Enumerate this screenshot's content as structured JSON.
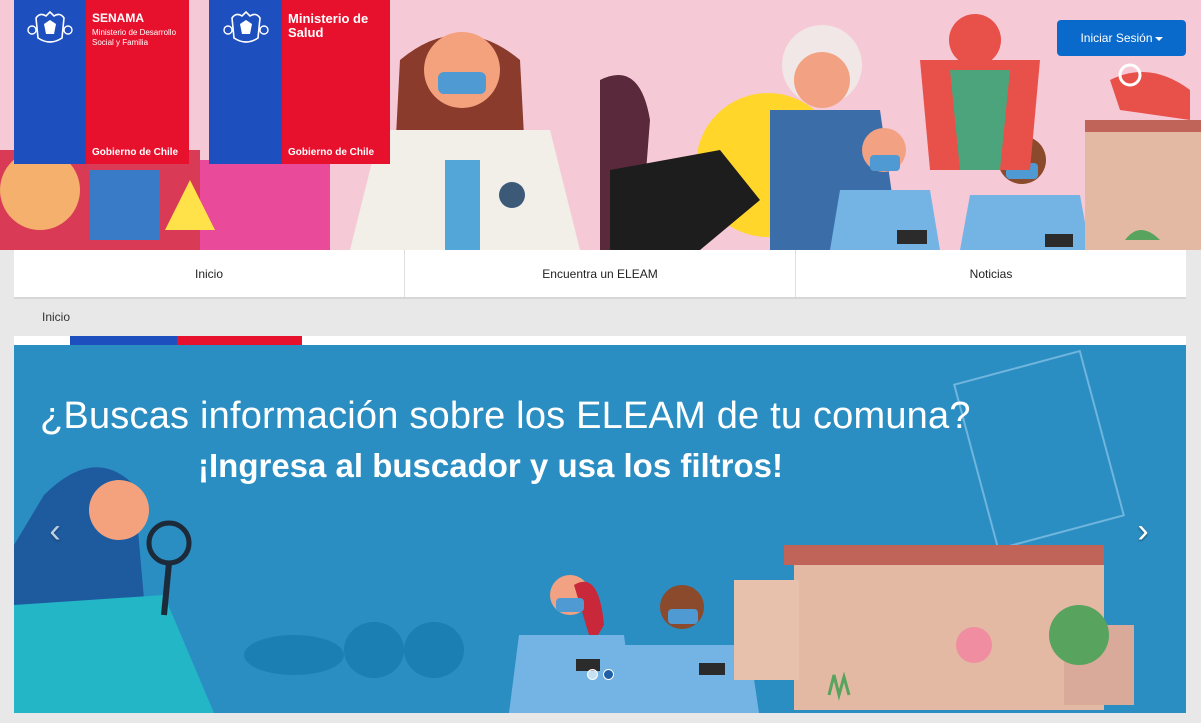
{
  "header": {
    "logo_senama": {
      "title": "SENAMA",
      "subtitle": "Ministerio de Desarrollo Social y Familia",
      "footer": "Gobierno de Chile"
    },
    "logo_salud": {
      "title": "Ministerio de Salud",
      "footer": "Gobierno de Chile"
    },
    "login_label": "Iniciar Sesión"
  },
  "nav": {
    "items": [
      {
        "label": "Inicio"
      },
      {
        "label": "Encuentra un ELEAM"
      },
      {
        "label": "Noticias"
      }
    ]
  },
  "breadcrumb": "Inicio",
  "carousel": {
    "title": "¿Buscas información sobre los ELEAM de tu comuna?",
    "subtitle": "¡Ingresa al buscador y usa los filtros!",
    "prev_label": "‹",
    "next_label": "›",
    "active_index": 1,
    "slide_count": 2
  },
  "colors": {
    "gov_blue": "#1e4fbf",
    "gov_red": "#e8112d",
    "button_blue": "#0a6acb",
    "hero_pink": "#f6c9d6",
    "carousel_blue": "#2b8ec2"
  }
}
